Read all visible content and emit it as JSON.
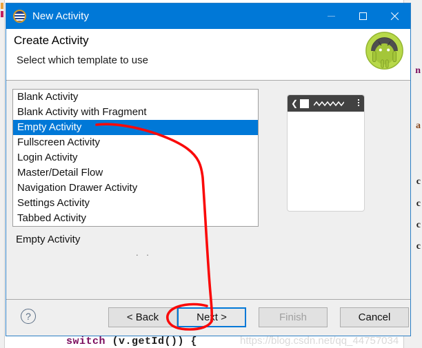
{
  "window": {
    "title": "New Activity",
    "app_icon": "eclipse-adt-icon",
    "controls": {
      "minimize": "minimize-icon",
      "maximize": "maximize-icon",
      "close": "close-icon"
    }
  },
  "header": {
    "title": "Create Activity",
    "subtitle": "Select which template to use",
    "logo": "android-robot-icon"
  },
  "template_list": {
    "items": [
      {
        "label": "Blank Activity",
        "selected": false
      },
      {
        "label": "Blank Activity with Fragment",
        "selected": false
      },
      {
        "label": "Empty Activity",
        "selected": true
      },
      {
        "label": "Fullscreen Activity",
        "selected": false
      },
      {
        "label": "Login Activity",
        "selected": false
      },
      {
        "label": "Master/Detail Flow",
        "selected": false
      },
      {
        "label": "Navigation Drawer Activity",
        "selected": false
      },
      {
        "label": "Settings Activity",
        "selected": false
      },
      {
        "label": "Tabbed Activity",
        "selected": false
      }
    ]
  },
  "selected_template": {
    "name": "Empty Activity",
    "description_placeholder": ". ."
  },
  "preview": {
    "appbar": {
      "back_icon": "chevron-left-icon",
      "app_square_icon": "app-square-icon",
      "title_placeholder_icon": "zigzag-placeholder-icon",
      "overflow_icon": "overflow-menu-icon"
    }
  },
  "buttons": {
    "help": "?",
    "back": "< Back",
    "next": "Next >",
    "finish": "Finish",
    "cancel": "Cancel"
  },
  "watermark": {
    "text": "https://blog.csdn.net/qq_44757034"
  },
  "background_code": {
    "bottom_line_keyword": "switch",
    "bottom_line_rest": " (v.getId()) {",
    "right_fragments": [
      "n",
      "a",
      "c",
      "c",
      "c",
      "c"
    ]
  },
  "colors": {
    "accent_blue": "#0078d7",
    "title_bar": "#0078d7",
    "dialog_bg": "#efefef",
    "list_bg": "#ffffff",
    "appbar_dark": "#424242",
    "annotation_red": "#fa0a0a",
    "disabled_text": "#a0a0a0"
  },
  "annotation": {
    "type": "hand-drawn-red-marker",
    "targets": [
      "Empty Activity",
      "Next >"
    ]
  }
}
